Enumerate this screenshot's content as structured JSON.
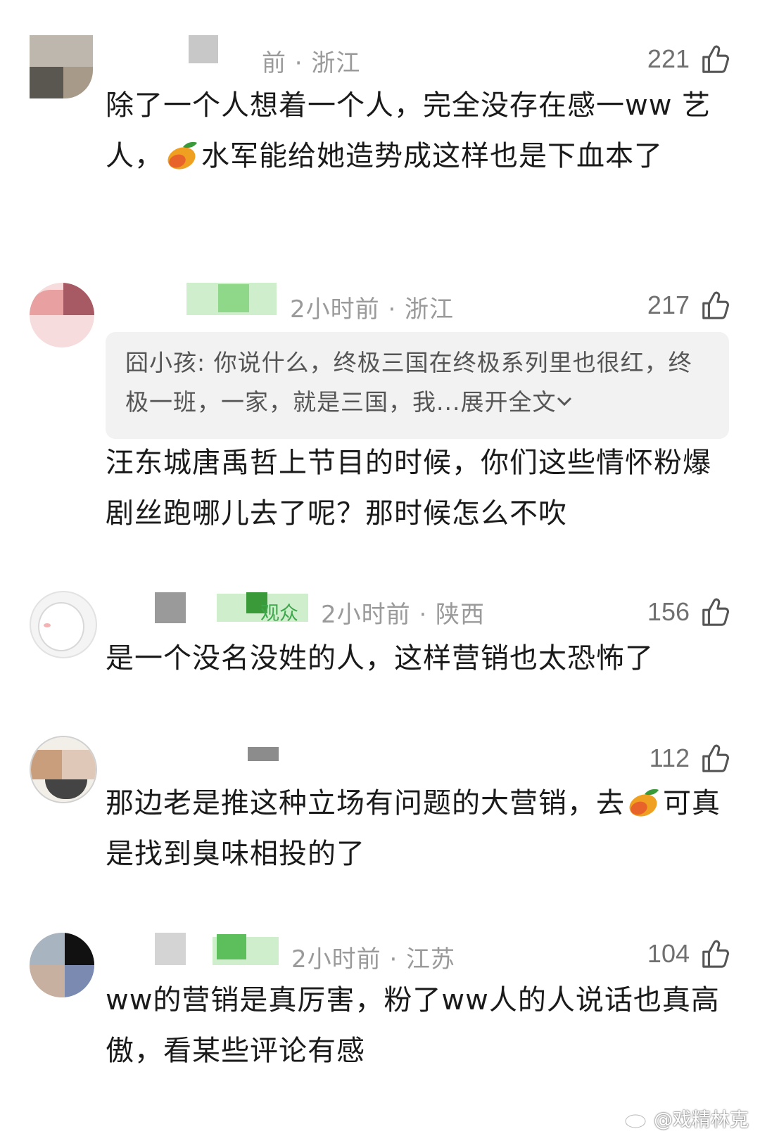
{
  "comments": [
    {
      "meta": "前 · 浙江",
      "likes": "221",
      "text_parts": [
        "除了一个人想着一个人，完全没存在感一ww 艺人，",
        "水军能给她造势成这样也是下血本了"
      ]
    },
    {
      "meta": "2小时前 · 浙江",
      "likes": "217",
      "quote_text": "囧小孩: 你说什么，终极三国在终极系列里也很红，终极一班，一家，就是三国，我...",
      "quote_expand": "展开全文",
      "text": "汪东城唐禹哲上节目的时候，你们这些情怀粉爆剧丝跑哪儿去了呢？那时候怎么不吹"
    },
    {
      "badge": "观众",
      "meta": "2小时前 · 陕西",
      "likes": "156",
      "text": "是一个没名没姓的人，这样营销也太恐怖了"
    },
    {
      "likes": "112",
      "text_parts": [
        "那边老是推这种立场有问题的大营销，去",
        "可真是找到臭味相投的了"
      ]
    },
    {
      "meta": "2小时前 · 江苏",
      "likes": "104",
      "text": "ww的营销是真厉害，粉了ww人的人说话也真高傲，看某些评论有感"
    }
  ],
  "watermark": "@戏精林克",
  "icons": [
    "thumbs-up-icon",
    "mango-emoji-icon",
    "chevron-down-icon",
    "weibo-logo-icon"
  ],
  "colors": {
    "meta_gray": "#9a9a9a",
    "text": "#1a1a1a",
    "quote_bg": "#f2f2f2",
    "badge_green": "#3aa84a"
  }
}
